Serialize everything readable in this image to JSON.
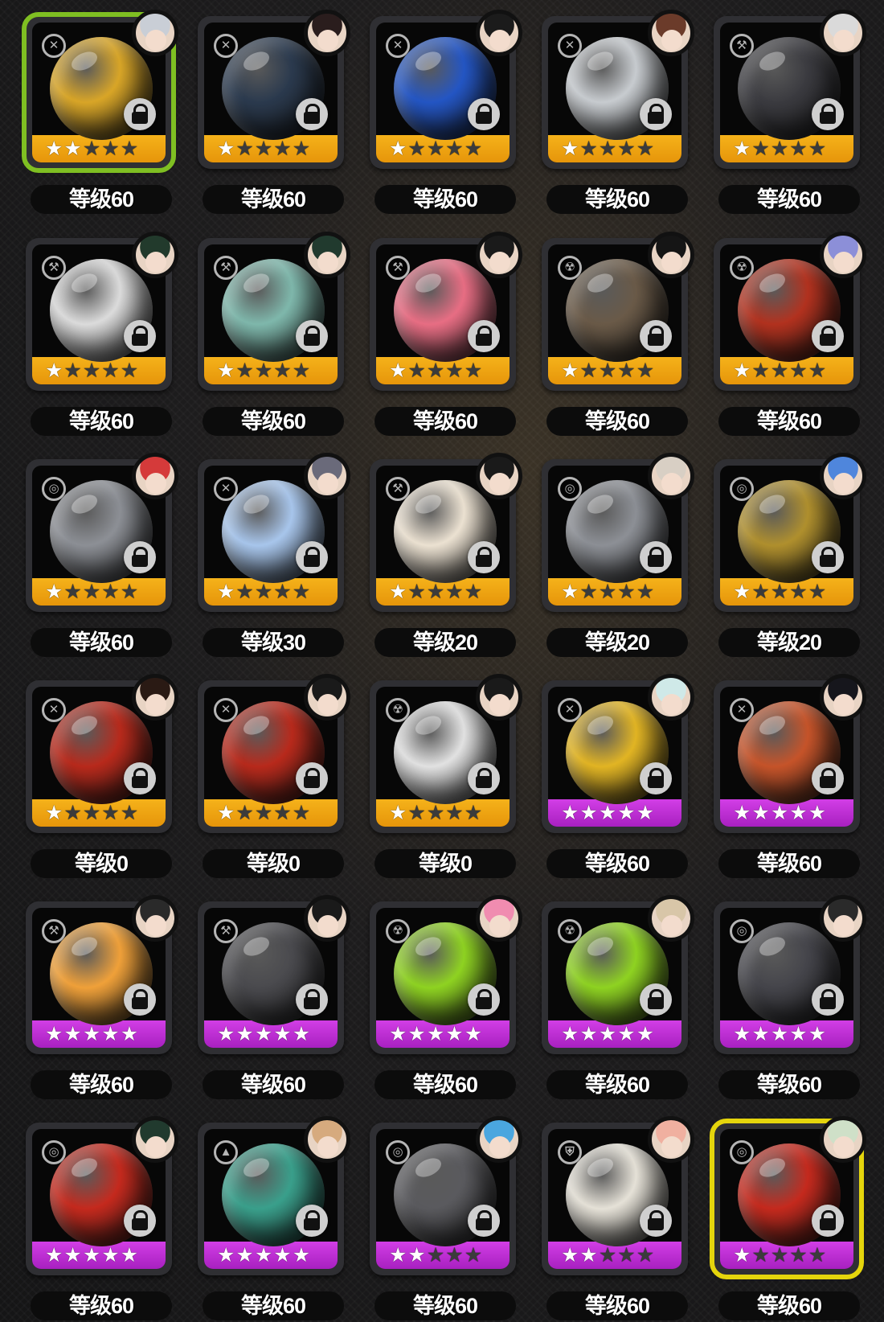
{
  "colors": {
    "rarity_a": "#f5b21a",
    "rarity_s": "#d23ee6",
    "selected_green": "#7fbf22",
    "selected_yellow": "#e5d50c"
  },
  "bangboo": [
    {
      "level": "等级60",
      "stars": 2,
      "rarity": "a",
      "type_icon": "crossed-tools-icon",
      "selection": "green",
      "theme": "#d9a628",
      "avatar_hair": "#c9ced6"
    },
    {
      "level": "等级60",
      "stars": 1,
      "rarity": "a",
      "type_icon": "crossed-tools-icon",
      "selection": "",
      "theme": "#2b3a4e",
      "avatar_hair": "#2a1d1d"
    },
    {
      "level": "等级60",
      "stars": 1,
      "rarity": "a",
      "type_icon": "crossed-tools-icon",
      "selection": "",
      "theme": "#2456c4",
      "avatar_hair": "#1b1b1b"
    },
    {
      "level": "等级60",
      "stars": 1,
      "rarity": "a",
      "type_icon": "crossed-tools-icon",
      "selection": "",
      "theme": "#c8ccd0",
      "avatar_hair": "#6b3b2a"
    },
    {
      "level": "等级60",
      "stars": 1,
      "rarity": "a",
      "type_icon": "hammer-icon",
      "selection": "",
      "theme": "#3b3b40",
      "avatar_hair": "#dadada"
    },
    {
      "level": "等级60",
      "stars": 1,
      "rarity": "a",
      "type_icon": "hammer-icon",
      "selection": "",
      "theme": "#dcdcdc",
      "avatar_hair": "#223a2c"
    },
    {
      "level": "等级60",
      "stars": 1,
      "rarity": "a",
      "type_icon": "hammer-icon",
      "selection": "",
      "theme": "#7fb8ac",
      "avatar_hair": "#213a2e"
    },
    {
      "level": "等级60",
      "stars": 1,
      "rarity": "a",
      "type_icon": "hammer-icon",
      "selection": "",
      "theme": "#e86e84",
      "avatar_hair": "#1a1a1a"
    },
    {
      "level": "等级60",
      "stars": 1,
      "rarity": "a",
      "type_icon": "radiation-icon",
      "selection": "",
      "theme": "#6a5a48",
      "avatar_hair": "#151515"
    },
    {
      "level": "等级60",
      "stars": 1,
      "rarity": "a",
      "type_icon": "radiation-icon",
      "selection": "",
      "theme": "#b2321f",
      "avatar_hair": "#8c8fd8"
    },
    {
      "level": "等级60",
      "stars": 1,
      "rarity": "a",
      "type_icon": "shield-ring-icon",
      "selection": "",
      "theme": "#8d9096",
      "avatar_hair": "#d53a3a"
    },
    {
      "level": "等级30",
      "stars": 1,
      "rarity": "a",
      "type_icon": "crossed-tools-icon",
      "selection": "",
      "theme": "#a8c6ec",
      "avatar_hair": "#6a6a7a"
    },
    {
      "level": "等级20",
      "stars": 1,
      "rarity": "a",
      "type_icon": "hammer-icon",
      "selection": "",
      "theme": "#ece2d2",
      "avatar_hair": "#1a1a1a"
    },
    {
      "level": "等级20",
      "stars": 1,
      "rarity": "a",
      "type_icon": "shield-ring-icon",
      "selection": "",
      "theme": "#8d9096",
      "avatar_hair": "#d8cfc4"
    },
    {
      "level": "等级20",
      "stars": 1,
      "rarity": "a",
      "type_icon": "shield-ring-icon",
      "selection": "",
      "theme": "#b0902e",
      "avatar_hair": "#4f86dc"
    },
    {
      "level": "等级0",
      "stars": 1,
      "rarity": "a",
      "type_icon": "crossed-tools-icon",
      "selection": "",
      "theme": "#b82a1c",
      "avatar_hair": "#2a1a14"
    },
    {
      "level": "等级0",
      "stars": 1,
      "rarity": "a",
      "type_icon": "crossed-tools-icon",
      "selection": "",
      "theme": "#b82a1c",
      "avatar_hair": "#1a1a1a"
    },
    {
      "level": "等级0",
      "stars": 1,
      "rarity": "a",
      "type_icon": "radiation-icon",
      "selection": "",
      "theme": "#e2e2e2",
      "avatar_hair": "#1a1a1a"
    },
    {
      "level": "等级60",
      "stars": 5,
      "rarity": "s",
      "type_icon": "crossed-tools-icon",
      "selection": "",
      "theme": "#e2b524",
      "avatar_hair": "#cfe9e8"
    },
    {
      "level": "等级60",
      "stars": 5,
      "rarity": "s",
      "type_icon": "crossed-tools-icon",
      "selection": "",
      "theme": "#c6542a",
      "avatar_hair": "#16161c"
    },
    {
      "level": "等级60",
      "stars": 5,
      "rarity": "s",
      "type_icon": "hammer-icon",
      "selection": "",
      "theme": "#f0a13a",
      "avatar_hair": "#2a2a2a"
    },
    {
      "level": "等级60",
      "stars": 5,
      "rarity": "s",
      "type_icon": "hammer-icon",
      "selection": "",
      "theme": "#4a4a4e",
      "avatar_hair": "#1a1a1a"
    },
    {
      "level": "等级60",
      "stars": 5,
      "rarity": "s",
      "type_icon": "radiation-icon",
      "selection": "",
      "theme": "#8fd322",
      "avatar_hair": "#f08cb0"
    },
    {
      "level": "等级60",
      "stars": 5,
      "rarity": "s",
      "type_icon": "radiation-icon",
      "selection": "",
      "theme": "#8fd322",
      "avatar_hair": "#d8c6a8"
    },
    {
      "level": "等级60",
      "stars": 5,
      "rarity": "s",
      "type_icon": "shield-ring-icon",
      "selection": "",
      "theme": "#45454b",
      "avatar_hair": "#2a2a2a"
    },
    {
      "level": "等级60",
      "stars": 5,
      "rarity": "s",
      "type_icon": "shield-ring-icon",
      "selection": "",
      "theme": "#c52a1e",
      "avatar_hair": "#213a2e"
    },
    {
      "level": "等级60",
      "stars": 5,
      "rarity": "s",
      "type_icon": "pyramid-icon",
      "selection": "",
      "theme": "#3aa08c",
      "avatar_hair": "#d6aa7e"
    },
    {
      "level": "等级60",
      "stars": 2,
      "rarity": "s",
      "type_icon": "shield-ring-icon",
      "selection": "",
      "theme": "#5a5a5e",
      "avatar_hair": "#4aa6df"
    },
    {
      "level": "等级60",
      "stars": 2,
      "rarity": "s",
      "type_icon": "badge-icon",
      "selection": "",
      "theme": "#e6e2d8",
      "avatar_hair": "#f0b0a0"
    },
    {
      "level": "等级60",
      "stars": 1,
      "rarity": "s",
      "type_icon": "shield-ring-icon",
      "selection": "yellow",
      "theme": "#c52a1e",
      "avatar_hair": "#cfe0c8"
    }
  ]
}
